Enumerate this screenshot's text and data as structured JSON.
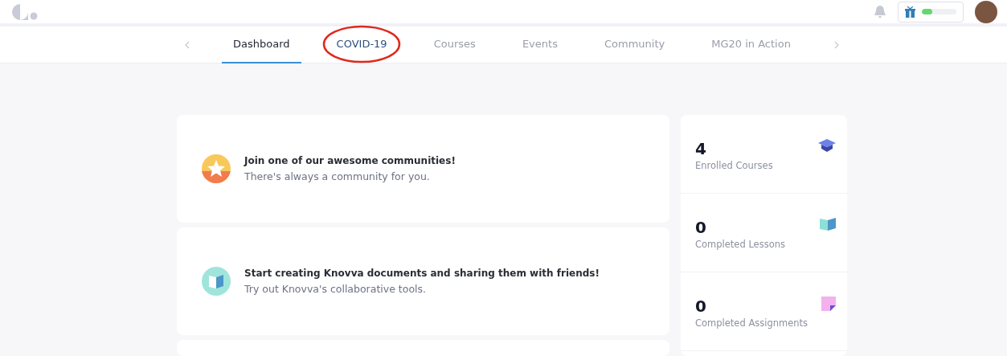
{
  "header": {
    "reward_progress": {
      "level": 0.3
    }
  },
  "tabs": [
    {
      "label": "Dashboard",
      "selected": true,
      "circled": false
    },
    {
      "label": "COVID-19",
      "selected": false,
      "circled": true
    },
    {
      "label": "Courses",
      "selected": false,
      "circled": false
    },
    {
      "label": "Events",
      "selected": false,
      "circled": false
    },
    {
      "label": "Community",
      "selected": false,
      "circled": false
    },
    {
      "label": "MG20 in Action",
      "selected": false,
      "circled": false
    }
  ],
  "cards": [
    {
      "kind": "star",
      "title": "Join one of our awesome communities!",
      "subtitle": "There's always a community for you."
    },
    {
      "kind": "book",
      "title": "Start creating Knovva documents and sharing them with friends!",
      "subtitle": "Try out Knovva's collaborative tools."
    }
  ],
  "stats": [
    {
      "kind": "cap",
      "value": "4",
      "label": "Enrolled Courses"
    },
    {
      "kind": "book",
      "value": "0",
      "label": "Completed Lessons"
    },
    {
      "kind": "note",
      "value": "0",
      "label": "Completed Assignments"
    }
  ]
}
